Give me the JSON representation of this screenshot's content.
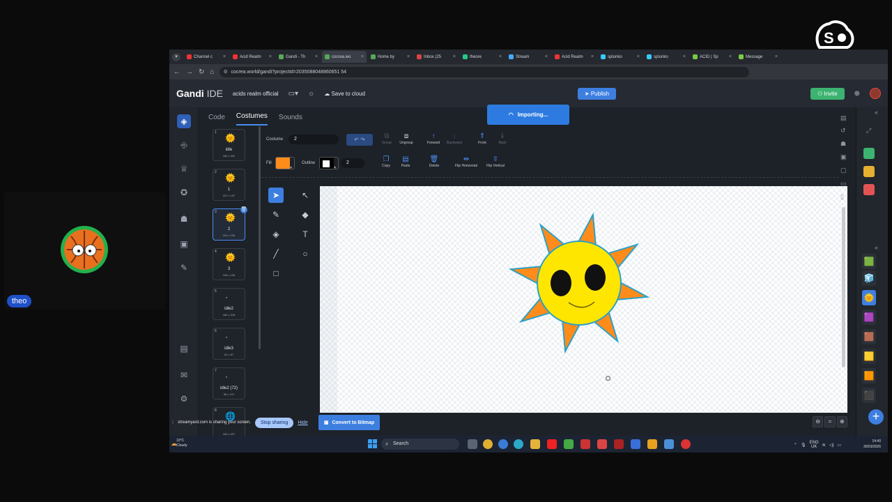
{
  "participant": {
    "name": "theo"
  },
  "brand": {
    "text": "streamyard"
  },
  "browser": {
    "tabs": [
      {
        "label": "Channel c",
        "color": "#e33"
      },
      {
        "label": "Acid Realm",
        "color": "#e33"
      },
      {
        "label": "Gandi - Th",
        "color": "#5a5"
      },
      {
        "label": "cocrea.wo",
        "color": "#5a5",
        "active": true
      },
      {
        "label": "Home by",
        "color": "#5a5"
      },
      {
        "label": "Inbox (25",
        "color": "#d44"
      },
      {
        "label": "theore",
        "color": "#2c8"
      },
      {
        "label": "Stream",
        "color": "#4af"
      },
      {
        "label": "Acid Realm",
        "color": "#e33"
      },
      {
        "label": "splunko",
        "color": "#3cf"
      },
      {
        "label": "splunko",
        "color": "#3cf"
      },
      {
        "label": "ACID | Sp",
        "color": "#7c4"
      },
      {
        "label": "Message",
        "color": "#7c4"
      }
    ],
    "url": "cocrea.world/gandi?projectId=2035088048860651 54"
  },
  "ide": {
    "logo_bold": "Gandi",
    "logo_light": "IDE",
    "project_name": "acids realm official",
    "save_label": "Save to cloud",
    "publish_label": "Publish",
    "invite_label": "Invite",
    "tabs": [
      "Code",
      "Costumes",
      "Sounds"
    ],
    "active_tab": "Costumes",
    "importing_label": "Importing..."
  },
  "paint": {
    "costume_label": "Costume",
    "costume_name": "2",
    "fill_label": "Fill",
    "fill_color": "#ff8c1a",
    "outline_label": "Outline",
    "outline_color": "#000000",
    "outline_width": "2",
    "buttons": {
      "group": "Group",
      "ungroup": "Ungroup",
      "forward": "Forward",
      "backward": "Backward",
      "front": "Front",
      "back": "Back",
      "copy": "Copy",
      "paste": "Paste",
      "delete": "Delete",
      "flip_h": "Flip Horizontal",
      "flip_v": "Flip Vertical"
    },
    "convert_label": "Convert to Bitmap"
  },
  "costumes": [
    {
      "num": "1",
      "name": "idle",
      "size": "160 x 331"
    },
    {
      "num": "2",
      "name": "1",
      "size": "197 x 197"
    },
    {
      "num": "3",
      "name": "2",
      "size": "100 x 100"
    },
    {
      "num": "4",
      "name": "3",
      "size": "108 x 106"
    },
    {
      "num": "5",
      "name": "idle2",
      "size": "184 x 318"
    },
    {
      "num": "6",
      "name": "idle3",
      "size": "62 x 87"
    },
    {
      "num": "7",
      "name": "idle2 (72)",
      "size": "96 x 272"
    },
    {
      "num": "8",
      "name": "",
      "size": "160 x 327"
    }
  ],
  "share": {
    "text": "streamyard.com is sharing your screen.",
    "stop_label": "Stop sharing",
    "hide_label": "Hide"
  },
  "taskbar": {
    "temp": "10°C",
    "weather": "Cloudy",
    "search": "Search",
    "lang1": "ENG",
    "lang2": "UK",
    "time": "14:40",
    "date": "30/03/2026"
  },
  "colors": {
    "sun_fill": "#ffe600",
    "ray_fill": "#ff8c1a",
    "outline": "#2aa0c8",
    "accent": "#3d7fe0"
  }
}
